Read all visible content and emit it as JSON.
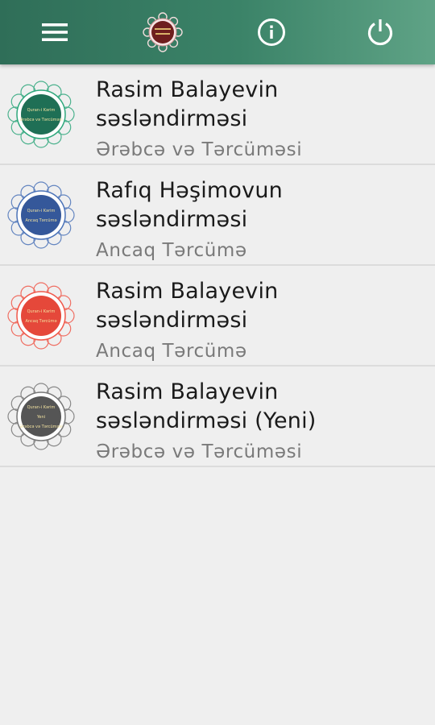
{
  "colors": {
    "appbar": "#3b8368",
    "badge_ring_green": "#2fa77c",
    "badge_ring_blue": "#4b73b8",
    "badge_ring_red": "#f0584a",
    "badge_ring_gray": "#777777"
  },
  "appbar": {
    "menu_icon": "hamburger-menu-icon",
    "logo_icon": "quran-logo-icon",
    "info_icon": "info-icon",
    "power_icon": "power-icon"
  },
  "items": [
    {
      "title_line1": "Rasim Balayevin",
      "title_line2": "səsləndirməsi",
      "subtitle": "Ərəbcə və Tərcüməsi",
      "badge_color": "#2fa77c",
      "badge_center": "#1f6f55",
      "badge_lines": [
        "Quran-i Kərim",
        "Ərəbcə və Tərcüməsi"
      ]
    },
    {
      "title_line1": "Rafıq Həşimovun",
      "title_line2": "səsləndirməsi",
      "subtitle": "Ancaq Tərcümə",
      "badge_color": "#4b73b8",
      "badge_center": "#35589a",
      "badge_lines": [
        "Quran-i Kərim",
        "Ancaq Tərcümə"
      ]
    },
    {
      "title_line1": "Rasim Balayevin",
      "title_line2": "səsləndirməsi",
      "subtitle": "Ancaq Tərcümə",
      "badge_color": "#f0584a",
      "badge_center": "#e5483a",
      "badge_lines": [
        "Quran-i Kərim",
        "Ancaq Tərcümə"
      ]
    },
    {
      "title_line1": "Rasim Balayevin",
      "title_line2": "səsləndirməsi (Yeni)",
      "subtitle": "Ərəbcə və Tərcüməsi",
      "badge_color": "#777777",
      "badge_center": "#555555",
      "badge_lines": [
        "Quran-i Kərim",
        "Yeni",
        "Ərəbcə və Tərcüməsi"
      ]
    }
  ]
}
